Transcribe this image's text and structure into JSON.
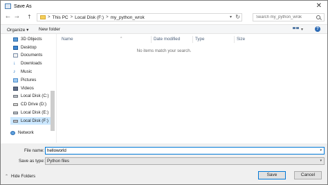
{
  "window": {
    "title": "Save As",
    "close_glyph": "✕"
  },
  "address": {
    "back_glyph": "←",
    "forward_glyph": "→",
    "up_glyph": "↑",
    "breadcrumbs": [
      "This PC",
      "Local Disk (F:)",
      "my_python_wrok"
    ],
    "separator": ">",
    "refresh_glyph": "↻"
  },
  "search": {
    "placeholder": "Search my_python_wrok"
  },
  "toolbar": {
    "organize_label": "Organize ▾",
    "new_folder_label": "New folder",
    "help_glyph": "?"
  },
  "sidebar": {
    "items": [
      {
        "label": "3D Objects",
        "icon": "3d-objects-icon"
      },
      {
        "label": "Desktop",
        "icon": "desktop-icon"
      },
      {
        "label": "Documents",
        "icon": "documents-icon"
      },
      {
        "label": "Downloads",
        "icon": "downloads-icon"
      },
      {
        "label": "Music",
        "icon": "music-icon"
      },
      {
        "label": "Pictures",
        "icon": "pictures-icon"
      },
      {
        "label": "Videos",
        "icon": "videos-icon"
      },
      {
        "label": "Local Disk (C:)",
        "icon": "drive-icon"
      },
      {
        "label": "CD Drive (D:)",
        "icon": "cd-drive-icon"
      },
      {
        "label": "Local Disk (E:)",
        "icon": "drive-icon"
      },
      {
        "label": "Local Disk (F:)",
        "icon": "drive-icon",
        "selected": true
      },
      {
        "label": "Network",
        "icon": "network-icon"
      }
    ]
  },
  "file_list": {
    "columns": [
      "Name",
      "Date modified",
      "Type",
      "Size"
    ],
    "empty_message": "No items match your search."
  },
  "form": {
    "filename_label": "File name:",
    "filename_value": "helloworld",
    "filetype_label": "Save as type:",
    "filetype_value": "Python files"
  },
  "footer": {
    "hide_folders_label": "Hide Folders",
    "save_label": "Save",
    "cancel_label": "Cancel"
  },
  "colors": {
    "accent": "#0078d7",
    "selection": "#cce8ff",
    "panel_bg": "#f0f0f0"
  }
}
